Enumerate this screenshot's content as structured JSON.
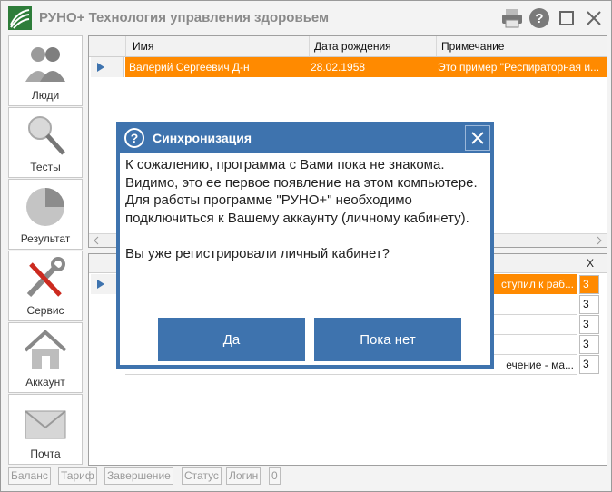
{
  "app": {
    "title": "РУНО+ Технология управления здоровьем",
    "accent": "#3e73ae",
    "selection_color": "#ff8a00"
  },
  "toolbar": {
    "icons": [
      "printer-icon",
      "help-icon",
      "maximize-icon",
      "close-icon"
    ]
  },
  "sidebar": {
    "items": [
      {
        "label": "Люди",
        "icon": "people-icon"
      },
      {
        "label": "Тесты",
        "icon": "test-icon"
      },
      {
        "label": "Результат",
        "icon": "pie-chart-icon"
      },
      {
        "label": "Сервис",
        "icon": "tools-icon"
      },
      {
        "label": "Аккаунт",
        "icon": "home-icon"
      },
      {
        "label": "Почта",
        "icon": "mail-icon"
      }
    ]
  },
  "people_grid": {
    "columns": [
      "Имя",
      "Дата рождения",
      "Примечание"
    ],
    "rows": [
      {
        "name": "Валерий Сергеевич Д-н",
        "birth": "28.02.1958",
        "note": "Это пример \"Респираторная и..."
      }
    ]
  },
  "results_grid": {
    "header_x": "X",
    "rows": [
      {
        "note": "ступил к раб...",
        "x": "3"
      },
      {
        "note": "",
        "x": "3"
      },
      {
        "note": "",
        "x": "3"
      },
      {
        "note": "",
        "x": "3"
      },
      {
        "note": "ечение - ма...",
        "x": "3"
      }
    ]
  },
  "statusbar": {
    "items": [
      "Баланс",
      "Тариф",
      "Завершение",
      "Статус",
      "Логин",
      "0"
    ]
  },
  "dialog": {
    "title": "Синхронизация",
    "message": "К сожалению, программа с Вами пока не знакома.\nВидимо, это ее первое появление на этом компьютере.\nДля работы программе \"РУНО+\" необходимо подключиться к Вашему аккаунту (личному кабинету).\n\nВы уже регистрировали личный кабинет?",
    "yes_label": "Да",
    "no_label": "Пока нет"
  }
}
